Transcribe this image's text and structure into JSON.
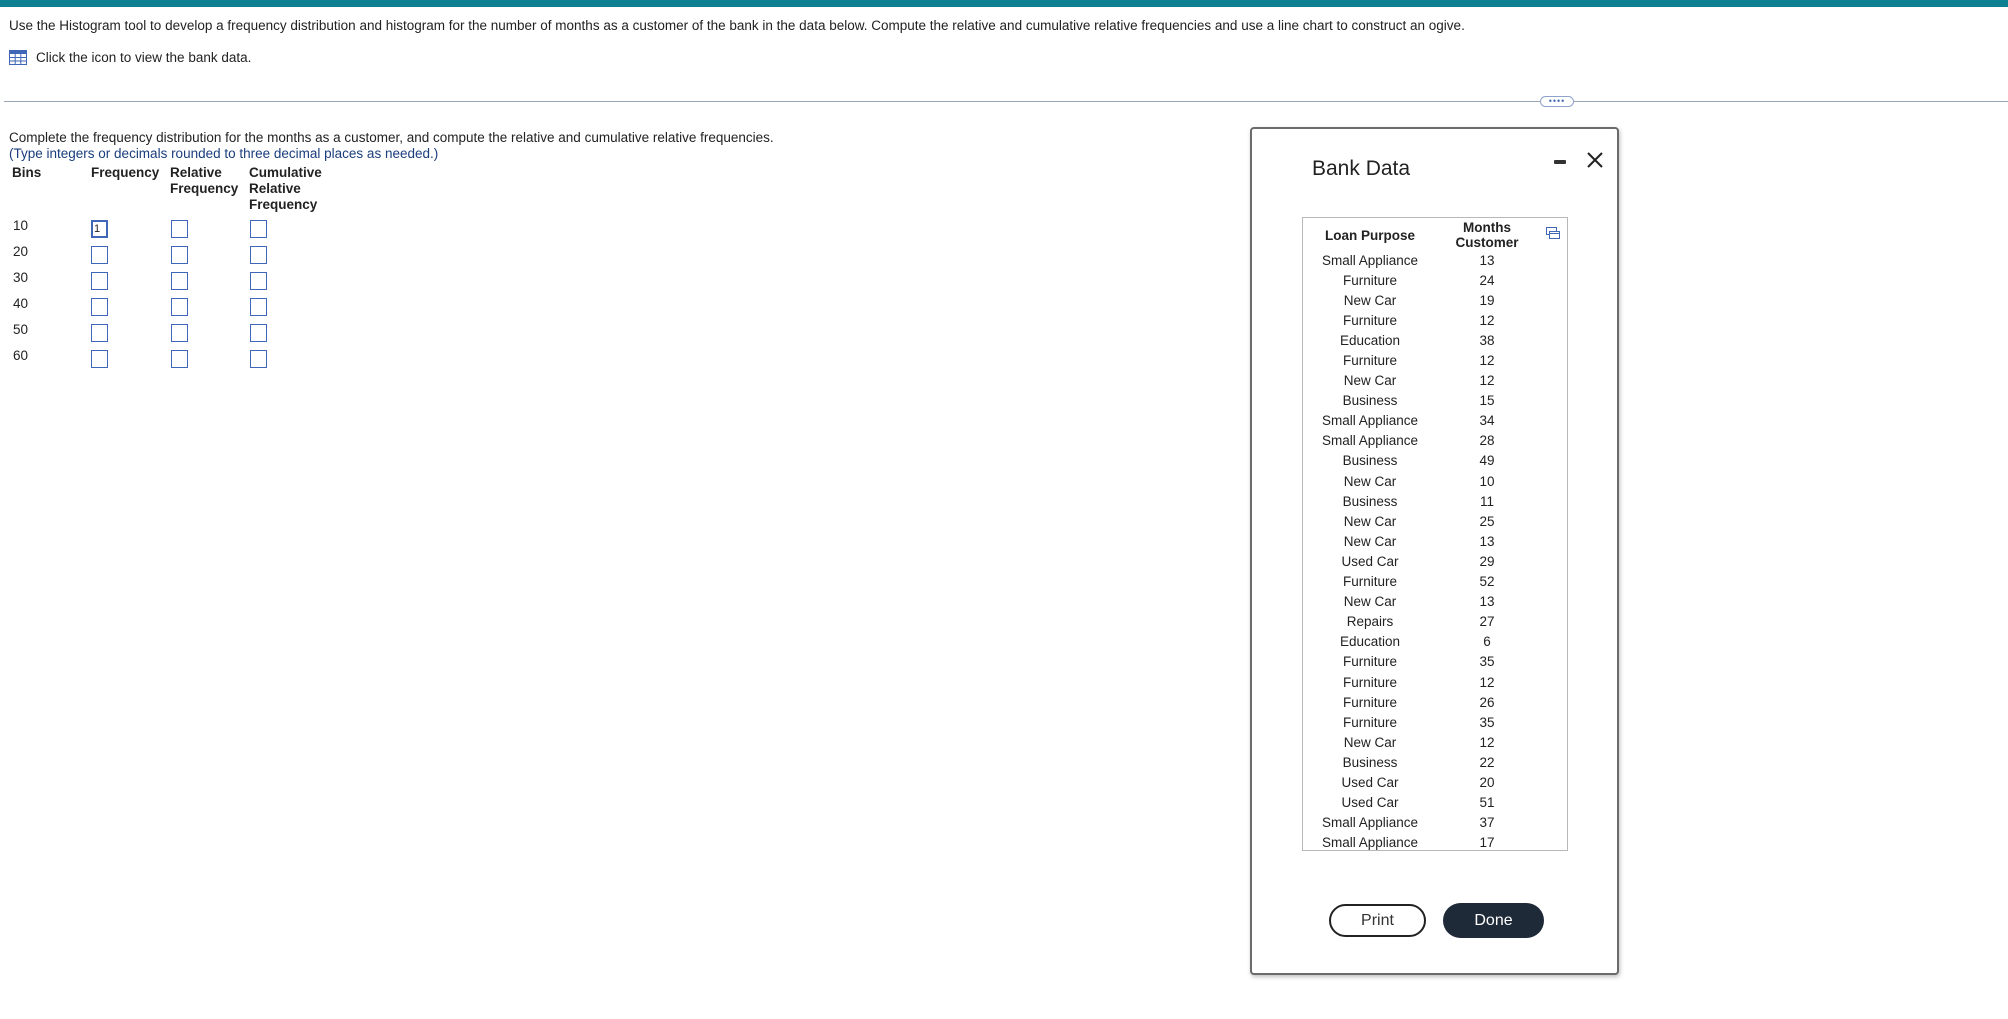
{
  "instruction": "Use the Histogram tool to develop a frequency distribution and histogram for the number of months as a customer of the bank in the data below. Compute the relative and cumulative relative frequencies and use a line chart to construct an ogive.",
  "data_link": {
    "label": "Click the icon to view the bank data."
  },
  "divider_handle": "••••",
  "prompt": "Complete the frequency distribution for the months as a customer, and compute the relative and cumulative relative frequencies.",
  "note": "(Type integers or decimals rounded to three decimal places as needed.)",
  "freq_table": {
    "headers": {
      "bins": "Bins",
      "frequency": "Frequency",
      "relative_line1": "Relative",
      "relative_line2": "Frequency",
      "cumulative_line1": "Cumulative",
      "cumulative_line2": "Relative",
      "cumulative_line3": "Frequency"
    },
    "rows": [
      {
        "bin": "10",
        "frequency": "1",
        "relative": "",
        "cumulative": ""
      },
      {
        "bin": "20",
        "frequency": "",
        "relative": "",
        "cumulative": ""
      },
      {
        "bin": "30",
        "frequency": "",
        "relative": "",
        "cumulative": ""
      },
      {
        "bin": "40",
        "frequency": "",
        "relative": "",
        "cumulative": ""
      },
      {
        "bin": "50",
        "frequency": "",
        "relative": "",
        "cumulative": ""
      },
      {
        "bin": "60",
        "frequency": "",
        "relative": "",
        "cumulative": ""
      }
    ]
  },
  "dialog": {
    "title": "Bank Data",
    "columns": [
      "Loan Purpose",
      "Months Customer"
    ],
    "rows": [
      [
        "Small Appliance",
        "13"
      ],
      [
        "Furniture",
        "24"
      ],
      [
        "New Car",
        "19"
      ],
      [
        "Furniture",
        "12"
      ],
      [
        "Education",
        "38"
      ],
      [
        "Furniture",
        "12"
      ],
      [
        "New Car",
        "12"
      ],
      [
        "Business",
        "15"
      ],
      [
        "Small Appliance",
        "34"
      ],
      [
        "Small Appliance",
        "28"
      ],
      [
        "Business",
        "49"
      ],
      [
        "New Car",
        "10"
      ],
      [
        "Business",
        "11"
      ],
      [
        "New Car",
        "25"
      ],
      [
        "New Car",
        "13"
      ],
      [
        "Used Car",
        "29"
      ],
      [
        "Furniture",
        "52"
      ],
      [
        "New Car",
        "13"
      ],
      [
        "Repairs",
        "27"
      ],
      [
        "Education",
        "6"
      ],
      [
        "Furniture",
        "35"
      ],
      [
        "Furniture",
        "12"
      ],
      [
        "Furniture",
        "26"
      ],
      [
        "Furniture",
        "35"
      ],
      [
        "New Car",
        "12"
      ],
      [
        "Business",
        "22"
      ],
      [
        "Used Car",
        "20"
      ],
      [
        "Used Car",
        "51"
      ],
      [
        "Small Appliance",
        "37"
      ],
      [
        "Small Appliance",
        "17"
      ]
    ],
    "print_label": "Print",
    "done_label": "Done"
  },
  "colors": {
    "top_bar": "#0f7f92",
    "note_text": "#1a3d7c",
    "input_border": "#3f67b5",
    "done_button": "#1f2a38"
  }
}
